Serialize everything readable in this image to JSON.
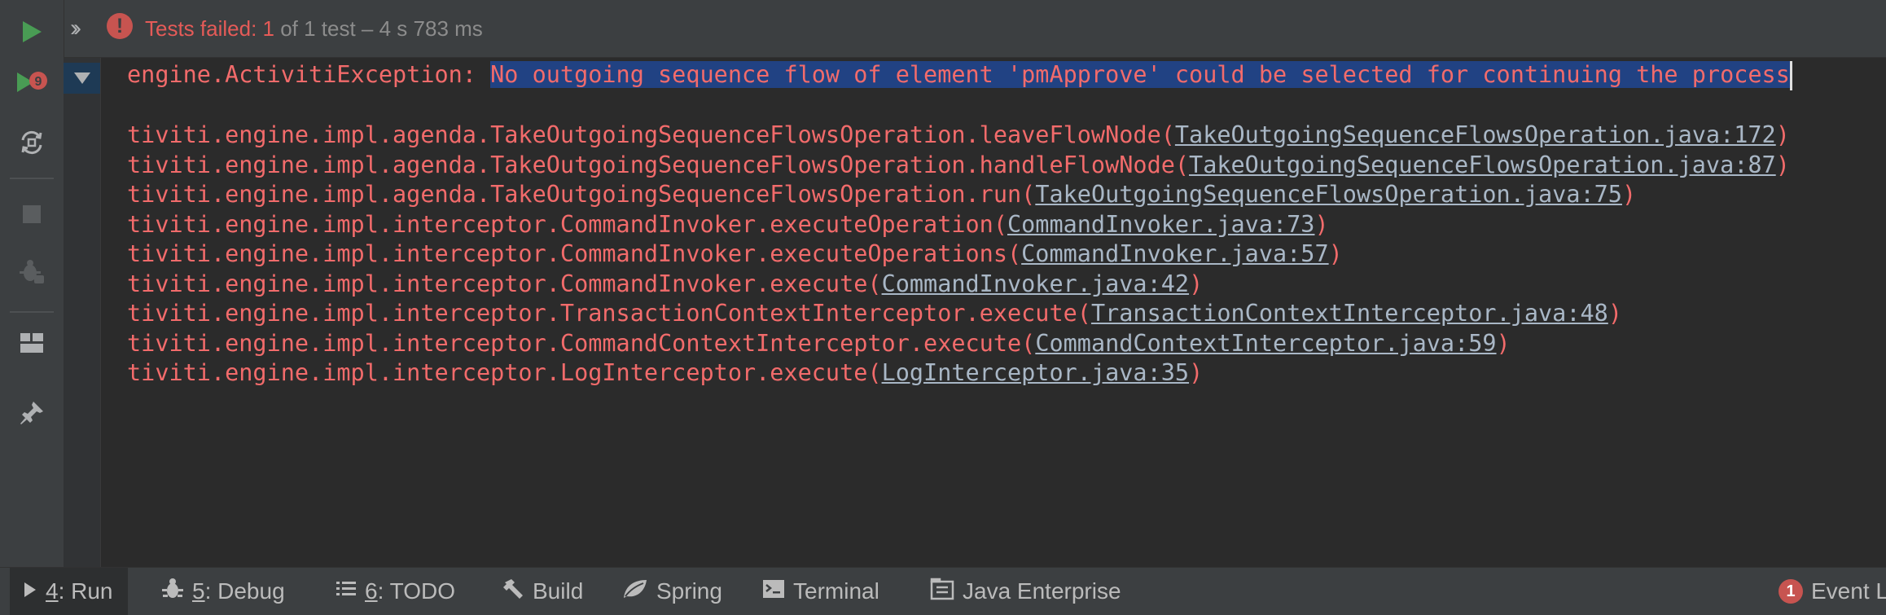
{
  "status": {
    "prefix": "Tests failed: ",
    "failed": "1",
    "rest": " of 1 test – 4 s 783 ms",
    "icon": "!"
  },
  "console": {
    "exception_prefix": "engine.ActivitiException: ",
    "exception_message": "No outgoing sequence flow of element 'pmApprove' could be selected for continuing the process",
    "frames": [
      {
        "method": "tiviti.engine.impl.agenda.TakeOutgoingSequenceFlowsOperation.leaveFlowNode(",
        "link": "TakeOutgoingSequenceFlowsOperation.java:172",
        "close": ")"
      },
      {
        "method": "tiviti.engine.impl.agenda.TakeOutgoingSequenceFlowsOperation.handleFlowNode(",
        "link": "TakeOutgoingSequenceFlowsOperation.java:87",
        "close": ")"
      },
      {
        "method": "tiviti.engine.impl.agenda.TakeOutgoingSequenceFlowsOperation.run(",
        "link": "TakeOutgoingSequenceFlowsOperation.java:75",
        "close": ")"
      },
      {
        "method": "tiviti.engine.impl.interceptor.CommandInvoker.executeOperation(",
        "link": "CommandInvoker.java:73",
        "close": ")"
      },
      {
        "method": "tiviti.engine.impl.interceptor.CommandInvoker.executeOperations(",
        "link": "CommandInvoker.java:57",
        "close": ")"
      },
      {
        "method": "tiviti.engine.impl.interceptor.CommandInvoker.execute(",
        "link": "CommandInvoker.java:42",
        "close": ")"
      },
      {
        "method": "tiviti.engine.impl.interceptor.TransactionContextInterceptor.execute(",
        "link": "TransactionContextInterceptor.java:48",
        "close": ")"
      },
      {
        "method": "tiviti.engine.impl.interceptor.CommandContextInterceptor.execute(",
        "link": "CommandContextInterceptor.java:59",
        "close": ")"
      },
      {
        "method": "tiviti.engine.impl.interceptor.LogInterceptor.execute(",
        "link": "LogInterceptor.java:35",
        "close": ")"
      }
    ]
  },
  "toolbar": {
    "rerun_failed_badge": "9",
    "icons": [
      "play-icon",
      "rerun-failed-icon",
      "toggle-autotest-icon",
      "stop-icon",
      "debug-disabled-icon",
      "layout-icon",
      "pin-icon"
    ]
  },
  "tool_windows": [
    {
      "number": "4",
      "label": ": Run",
      "icon": "run-triangle-icon",
      "active": true
    },
    {
      "number": "5",
      "label": ": Debug",
      "icon": "bug-icon"
    },
    {
      "number": "6",
      "label": ": TODO",
      "icon": "list-icon"
    },
    {
      "label": "Build",
      "icon": "hammer-icon"
    },
    {
      "label": "Spring",
      "icon": "leaf-icon"
    },
    {
      "label": "Terminal",
      "icon": "terminal-icon"
    },
    {
      "label": "Java Enterprise",
      "icon": "enterprise-icon"
    }
  ],
  "event_log": {
    "label": "Event L",
    "badge": "1"
  },
  "colors": {
    "error": "#e55b58",
    "selection": "#214283",
    "link": "#a9b7c6",
    "run_green": "#499c54"
  }
}
